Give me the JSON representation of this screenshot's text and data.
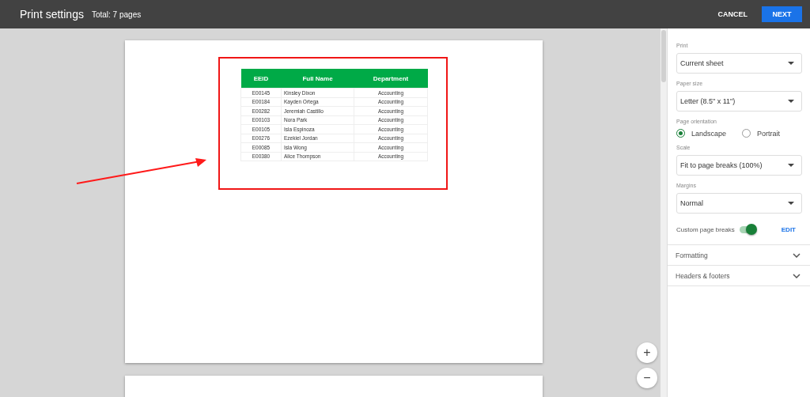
{
  "header": {
    "title": "Print settings",
    "total": "Total: 7 pages",
    "cancel": "CANCEL",
    "next": "NEXT"
  },
  "preview": {
    "table": {
      "columns": [
        "EEID",
        "Full Name",
        "Department"
      ],
      "rows": [
        [
          "E00145",
          "Kinsley Dixon",
          "Accounting"
        ],
        [
          "E00184",
          "Kayden Ortega",
          "Accounting"
        ],
        [
          "E00282",
          "Jeremiah Castillo",
          "Accounting"
        ],
        [
          "E00103",
          "Nora Park",
          "Accounting"
        ],
        [
          "E00105",
          "Isla Espinoza",
          "Accounting"
        ],
        [
          "E00276",
          "Ezekiel Jordan",
          "Accounting"
        ],
        [
          "E00085",
          "Isla Wong",
          "Accounting"
        ],
        [
          "E00380",
          "Alice Thompson",
          "Accounting"
        ]
      ]
    },
    "zoom_in": "+",
    "zoom_out": "−"
  },
  "settings": {
    "dropdowns": [
      {
        "label": "Print",
        "value": "Current sheet"
      },
      {
        "label": "Paper size",
        "value": "Letter (8.5\" x 11\")"
      }
    ],
    "orientation": {
      "label": "Page orientation",
      "options": [
        {
          "label": "Landscape",
          "selected": true
        },
        {
          "label": "Portrait",
          "selected": false
        }
      ]
    },
    "dropdowns_2": [
      {
        "label": "Scale",
        "value": "Fit to page breaks (100%)"
      },
      {
        "label": "Margins",
        "value": "Normal"
      }
    ],
    "custom_page_breaks": {
      "label": "Custom page breaks",
      "on": true,
      "action": "EDIT"
    },
    "sections": [
      {
        "label": "Formatting",
        "expanded": false
      },
      {
        "label": "Headers & footers",
        "expanded": false
      }
    ]
  }
}
